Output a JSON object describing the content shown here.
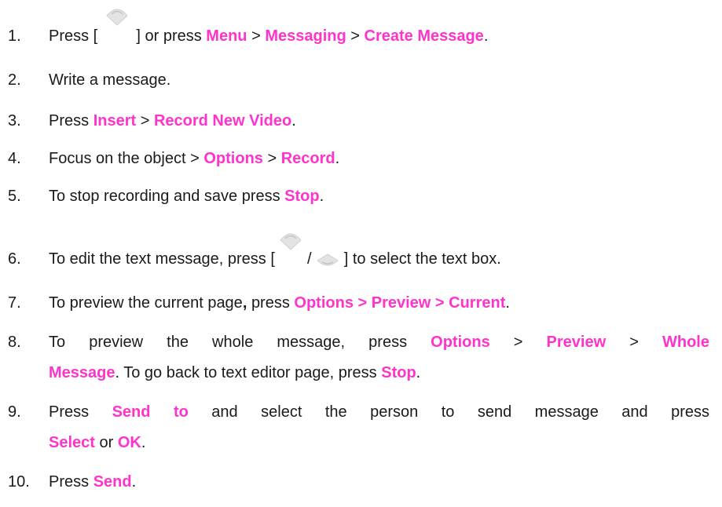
{
  "steps": [
    {
      "num": "1.",
      "pre": "Press [",
      "mid": "] or press",
      "menu": "Menu",
      "sep1": ">",
      "messaging": "Messaging",
      "sep2": ">",
      "create": "Create Message",
      "end": "."
    },
    {
      "num": "2.",
      "text": "Write a message."
    },
    {
      "num": "3.",
      "pre": "Press",
      "insert": "Insert",
      "sep": ">",
      "record_new": "Record New Video",
      "end": "."
    },
    {
      "num": "4.",
      "pre": "Focus on the object >",
      "options": "Options",
      "sep": ">",
      "record": "Record",
      "end": "."
    },
    {
      "num": "5.",
      "pre": "To stop recording and save press",
      "stop": "Stop",
      "end": "."
    },
    {
      "num": "6.",
      "pre": "To edit the text message, press [",
      "slash": "/",
      "post": "] to select the text box."
    },
    {
      "num": "7.",
      "pre": "To preview the current page",
      "comma": ",",
      "mid": "press",
      "path": "Options > Preview > Current",
      "end": "."
    },
    {
      "num": "8.",
      "pre": "To preview the whole message, press",
      "options": "Options",
      "sep1": ">",
      "preview": "Preview",
      "sep2": ">",
      "whole": "Whole",
      "message": "Message",
      "mid": ". To go back to text editor page, press",
      "stop": "Stop",
      "end": "."
    },
    {
      "num": "9.",
      "pre": "Press",
      "sendto": "Send to",
      "mid": "and select the person to send message and press",
      "select": "Select",
      "or": "or",
      "ok": "OK",
      "end": "."
    },
    {
      "num": "10.",
      "pre": "Press",
      "send": "Send",
      "end": "."
    }
  ],
  "colors": {
    "highlight": "#ff33cc",
    "text": "#1a1a1a"
  },
  "icons": {
    "step1_key": "up-key-icon",
    "step6_key_a": "up-key-icon",
    "step6_key_b": "down-key-icon"
  }
}
